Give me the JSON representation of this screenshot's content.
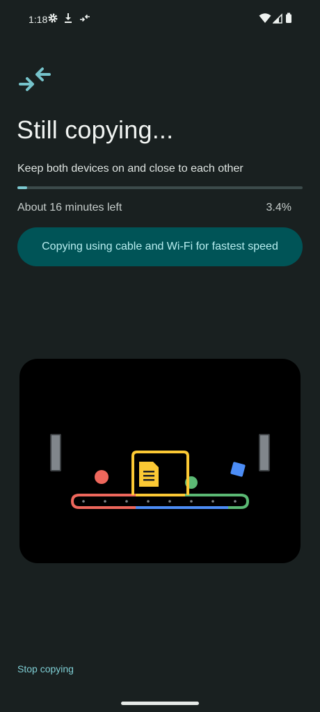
{
  "status_bar": {
    "time": "1:18",
    "icons": [
      "settings-gear-icon",
      "download-icon",
      "transfer-arrows-icon",
      "wifi-icon",
      "signal-icon",
      "battery-icon"
    ]
  },
  "header": {
    "app_icon": "transfer-arrows-icon",
    "title": "Still copying...",
    "subtitle": "Keep both devices on and close to each other"
  },
  "progress": {
    "fraction": 0.034,
    "time_left": "About 16 minutes left",
    "percent_label": "3.4%"
  },
  "info_pill": {
    "text": "Copying using cable and Wi-Fi for fastest speed"
  },
  "illustration": {
    "name": "conveyor-belt-illustration",
    "colors": {
      "red": "#ee675c",
      "yellow": "#fcc934",
      "green": "#5bb974",
      "blue": "#4c8df6",
      "gray": "#80868b"
    }
  },
  "footer": {
    "stop_label": "Stop copying"
  },
  "colors": {
    "background": "#192020",
    "accent": "#7cc9d1",
    "pill_background": "#005457",
    "pill_text": "#b8eef0"
  }
}
